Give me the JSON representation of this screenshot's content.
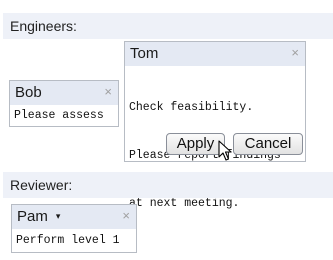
{
  "sections": {
    "engineers_label": "Engineers:",
    "reviewer_label": "Reviewer:"
  },
  "cards": {
    "bob": {
      "name": "Bob",
      "close_icon": "×",
      "text": "Please assess"
    },
    "tom": {
      "name": "Tom",
      "close_icon": "×",
      "text_lines": [
        "Check feasibility.",
        "Please report findings",
        "at next meeting."
      ],
      "apply_label": "Apply",
      "cancel_label": "Cancel"
    },
    "pam": {
      "name": "Pam",
      "dropdown_icon": "▾",
      "close_icon": "×",
      "text": "Perform level 1"
    }
  },
  "icons": {
    "close": "close-icon",
    "dropdown": "chevron-down-icon",
    "cursor": "mouse-pointer-icon"
  },
  "colors": {
    "section_bg": "#eef1f8",
    "card_header_bg": "#e4e9f3",
    "card_border": "#b7bcc4"
  }
}
